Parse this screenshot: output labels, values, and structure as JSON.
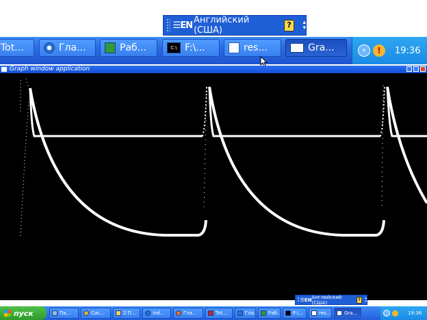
{
  "language_bar_top": {
    "label": "Английский (США)",
    "en_prefix": "EN",
    "help": "?"
  },
  "taskbar_top": {
    "buttons": [
      {
        "label": "Tot...",
        "icon": "total-commander-icon"
      },
      {
        "label": "Гла...",
        "icon": "browser-icon"
      },
      {
        "label": "Раб...",
        "icon": "excel-icon"
      },
      {
        "label": "F:\\...",
        "icon": "console-icon"
      },
      {
        "label": "res...",
        "icon": "word-icon"
      },
      {
        "label": "Gra...",
        "icon": "graph-window-icon"
      }
    ],
    "clock": "19:36"
  },
  "graph_window": {
    "title": "Graph window application",
    "colors": {
      "background": "#000000",
      "trace": "#ffffff"
    }
  },
  "language_bar_bottom": {
    "label": "Английский (США)",
    "en_prefix": "EN",
    "help": "?"
  },
  "taskbar_bottom": {
    "start_label": "пуск",
    "buttons": [
      {
        "label": "Па...",
        "icon": "folder-icon"
      },
      {
        "label": "Сис...",
        "icon": "system-icon"
      },
      {
        "label": "2 П...",
        "icon": "folder-group-icon"
      },
      {
        "label": "ind...",
        "icon": "browser-icon"
      },
      {
        "label": "Гла...",
        "icon": "browser-icon"
      },
      {
        "label": "Tot...",
        "icon": "total-commander-icon"
      },
      {
        "label": "Гла...",
        "icon": "browser-icon"
      },
      {
        "label": "Раб...",
        "icon": "excel-icon"
      },
      {
        "label": "F:\\...",
        "icon": "console-icon"
      },
      {
        "label": "res...",
        "icon": "word-icon"
      },
      {
        "label": "Gra...",
        "icon": "graph-window-icon"
      }
    ],
    "clock": "19:36"
  }
}
